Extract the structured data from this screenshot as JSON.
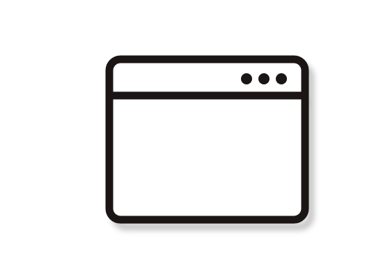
{
  "icon": {
    "name": "browser-window-icon",
    "stroke_color": "#1b1515",
    "shadow_color": "#9a9a9a",
    "fill_color": "#ffffff"
  }
}
